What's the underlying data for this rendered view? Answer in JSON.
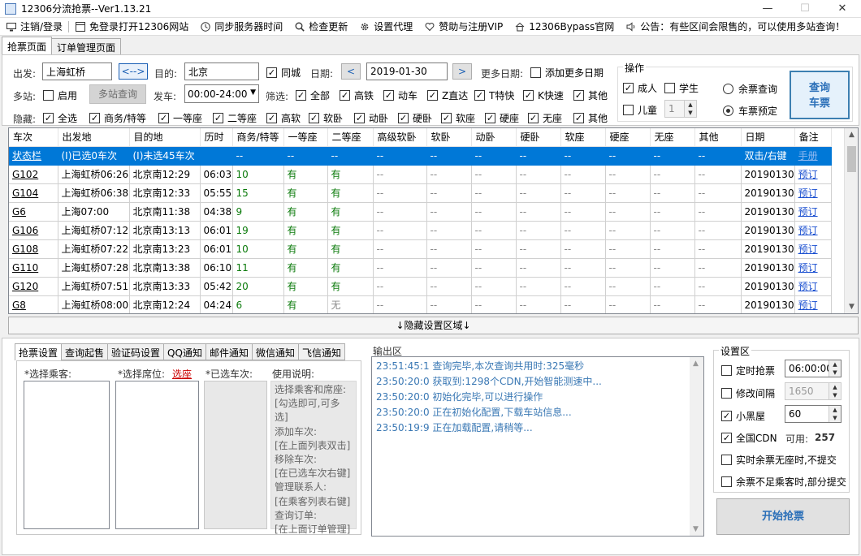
{
  "window": {
    "title": "12306分流抢票--Ver1.13.21",
    "minimize": "—",
    "maximize": "☐",
    "close": "✕"
  },
  "menu": [
    {
      "label": "注销/登录",
      "icon": "monitor-icon"
    },
    {
      "label": "免登录打开12306网站",
      "icon": "browser-icon"
    },
    {
      "label": "同步服务器时间",
      "icon": "clock-icon"
    },
    {
      "label": "检查更新",
      "icon": "search-icon"
    },
    {
      "label": "设置代理",
      "icon": "gear-icon"
    },
    {
      "label": "赞助与注册VIP",
      "icon": "heart-icon"
    },
    {
      "label": "12306Bypass官网",
      "icon": "home-icon"
    },
    {
      "label": "公告：有些区间会限售的，可以使用多站查询！",
      "icon": "speaker-icon"
    }
  ],
  "main_tabs": [
    "抢票页面",
    "订单管理页面"
  ],
  "search": {
    "from_label": "出发:",
    "from_value": "上海虹桥",
    "swap_label": "<-->",
    "to_label": "目的:",
    "to_value": "北京",
    "same_city": "同城",
    "date_label": "日期:",
    "prev": "<",
    "date_value": "2019-01-30",
    "next": ">",
    "more_dates_label": "更多日期:",
    "add_more_dates": "添加更多日期",
    "multi_label": "多站:",
    "enable": "启用",
    "multi_query": "多站查询",
    "depart_label": "发车:",
    "depart_value": "00:00-24:00",
    "filter_label": "筛选:",
    "filters": [
      "全部",
      "高铁",
      "动车",
      "Z直达",
      "T特快",
      "K快速",
      "其他"
    ],
    "hide_label": "隐藏:",
    "hides": [
      "全选",
      "商务/特等",
      "一等座",
      "二等座",
      "高软",
      "软卧",
      "动卧",
      "硬卧",
      "软座",
      "硬座",
      "无座",
      "其他"
    ]
  },
  "ops": {
    "title": "操作",
    "adult": "成人",
    "student": "学生",
    "child": "儿童",
    "child_count": "1",
    "remaining_query": "余票查询",
    "booking": "车票预定",
    "query_button": "查询\n车票"
  },
  "table": {
    "headers": [
      "车次",
      "出发地",
      "目的地",
      "历时",
      "商务/特等",
      "一等座",
      "二等座",
      "高级软卧",
      "软卧",
      "动卧",
      "硬卧",
      "软座",
      "硬座",
      "无座",
      "其他",
      "日期",
      "备注"
    ],
    "status_row": [
      "状态栏",
      "(I)已选0车次",
      "(I)未选45车次",
      "",
      "--",
      "--",
      "--",
      "--",
      "--",
      "--",
      "--",
      "--",
      "--",
      "--",
      "--",
      "双击/右键",
      "手册"
    ],
    "rows": [
      [
        "G102",
        "上海虹桥06:26",
        "北京南12:29",
        "06:03",
        "10",
        "有",
        "有",
        "--",
        "--",
        "--",
        "--",
        "--",
        "--",
        "--",
        "--",
        "20190130",
        "预订"
      ],
      [
        "G104",
        "上海虹桥06:38",
        "北京南12:33",
        "05:55",
        "15",
        "有",
        "有",
        "--",
        "--",
        "--",
        "--",
        "--",
        "--",
        "--",
        "--",
        "20190130",
        "预订"
      ],
      [
        "G6",
        "上海07:00",
        "北京南11:38",
        "04:38",
        "9",
        "有",
        "有",
        "--",
        "--",
        "--",
        "--",
        "--",
        "--",
        "--",
        "--",
        "20190130",
        "预订"
      ],
      [
        "G106",
        "上海虹桥07:12",
        "北京南13:13",
        "06:01",
        "19",
        "有",
        "有",
        "--",
        "--",
        "--",
        "--",
        "--",
        "--",
        "--",
        "--",
        "20190130",
        "预订"
      ],
      [
        "G108",
        "上海虹桥07:22",
        "北京南13:23",
        "06:01",
        "10",
        "有",
        "有",
        "--",
        "--",
        "--",
        "--",
        "--",
        "--",
        "--",
        "--",
        "20190130",
        "预订"
      ],
      [
        "G110",
        "上海虹桥07:28",
        "北京南13:38",
        "06:10",
        "11",
        "有",
        "有",
        "--",
        "--",
        "--",
        "--",
        "--",
        "--",
        "--",
        "--",
        "20190130",
        "预订"
      ],
      [
        "G120",
        "上海虹桥07:51",
        "北京南13:33",
        "05:42",
        "20",
        "有",
        "有",
        "--",
        "--",
        "--",
        "--",
        "--",
        "--",
        "--",
        "--",
        "20190130",
        "预订"
      ],
      [
        "G8",
        "上海虹桥08:00",
        "北京南12:24",
        "04:24",
        "6",
        "有",
        "无",
        "--",
        "--",
        "--",
        "--",
        "--",
        "--",
        "--",
        "--",
        "20190130",
        "预订"
      ]
    ]
  },
  "hide_settings": "↓隐藏设置区域↓",
  "sub_tabs": [
    "抢票设置",
    "查询起售",
    "验证码设置",
    "QQ通知",
    "邮件通知",
    "微信通知",
    "飞信通知"
  ],
  "select_passenger": "*选择乘客:",
  "select_seat": "*选择席位:",
  "select_seat_link": "选座",
  "selected_trains": "*已选车次:",
  "usage_title": "使用说明:",
  "usage_lines": [
    "选择乘客和席座:",
    "[勾选即可,可多选]",
    "添加车次:",
    "[在上面列表双击]",
    "移除车次:",
    "[在已选车次右键]",
    "管理联系人:",
    "[在乘客列表右键]",
    "查询订单:",
    "[在上面订单管理]"
  ],
  "output": {
    "title": "输出区",
    "lines": [
      "23:51:45:1   查询完毕,本次查询共用时:325毫秒",
      "23:50:20:0   获取到:1298个CDN,开始智能测速中...",
      "23:50:20:0   初始化完毕,可以进行操作",
      "23:50:20:0   正在初始化配置,下载车站信息...",
      "23:50:19:9   正在加载配置,请稍等..."
    ]
  },
  "settings": {
    "title": "设置区",
    "timed": "定时抢票",
    "timed_value": "06:00:00",
    "interval": "修改间隔",
    "interval_value": "1650",
    "blackroom": "小黑屋",
    "blackroom_value": "60",
    "cdn": "全国CDN",
    "cdn_available_label": "可用:",
    "cdn_available": "257",
    "realtime": "实时余票无座时,不提交",
    "partial": "余票不足乘客时,部分提交",
    "start": "开始抢票"
  }
}
